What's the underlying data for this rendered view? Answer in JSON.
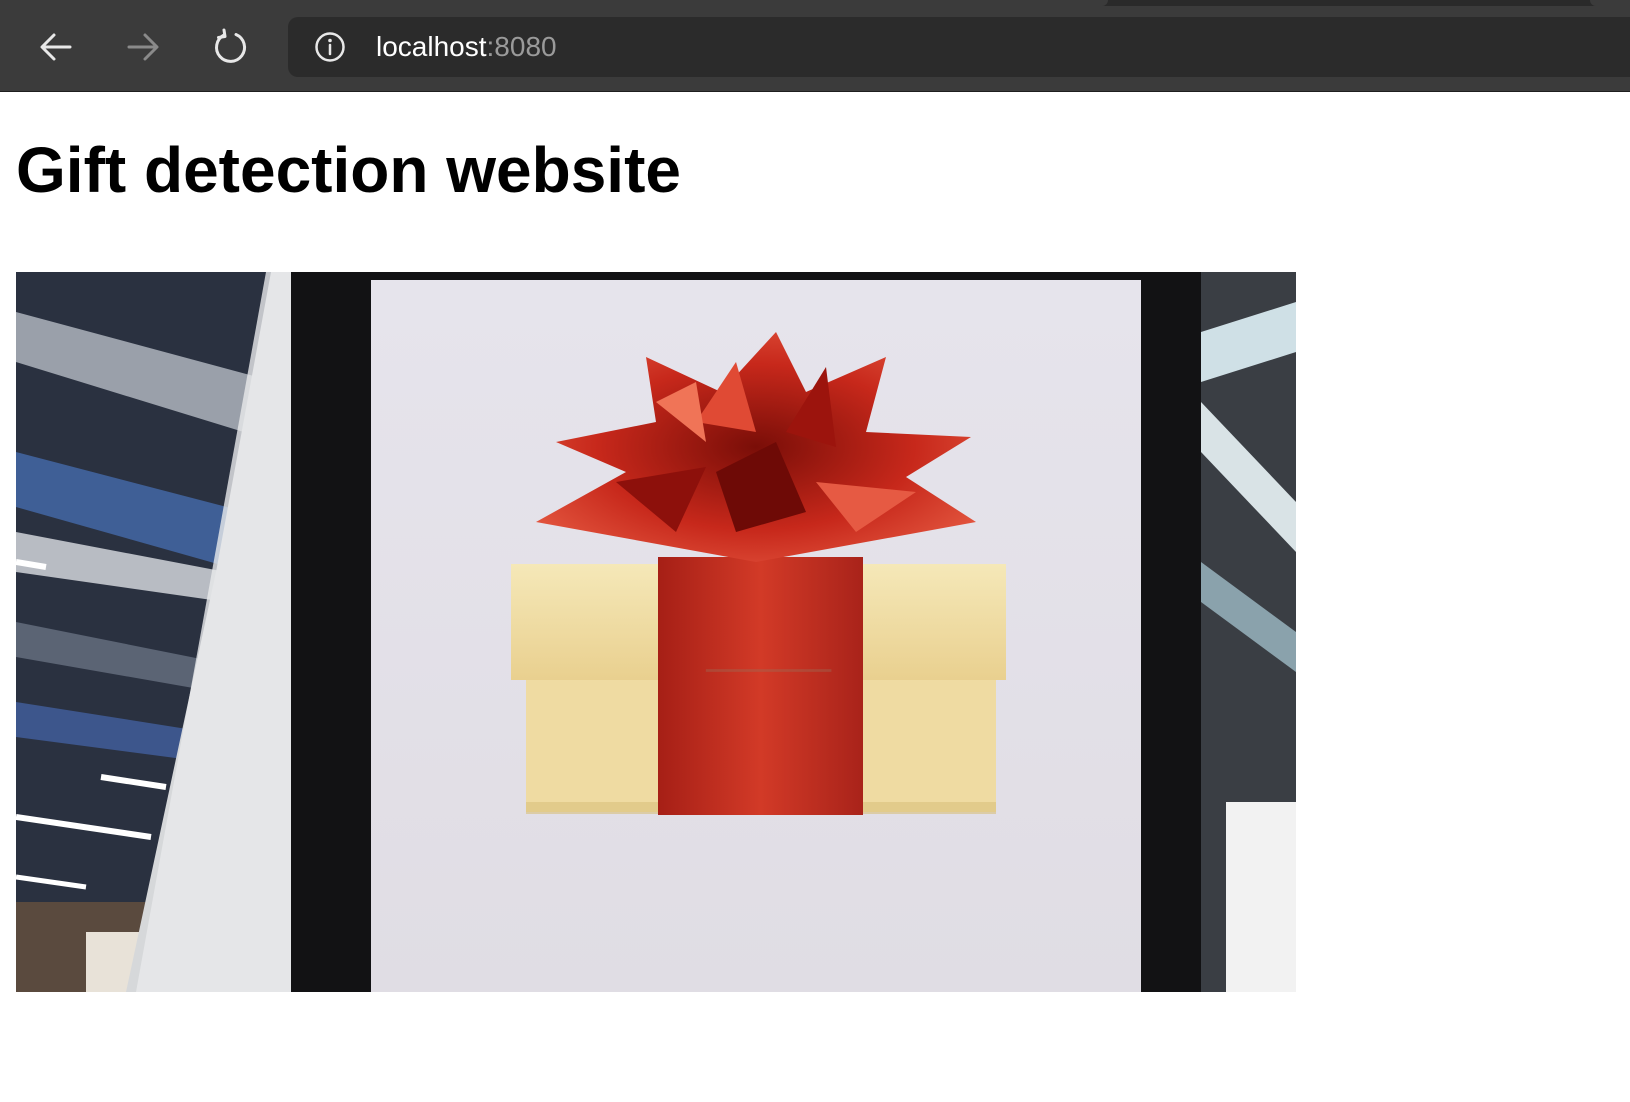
{
  "browser": {
    "url_host": "localhost",
    "url_port": ":8080",
    "icons": {
      "back": "arrow-left-icon",
      "forward": "arrow-right-icon",
      "reload": "reload-icon",
      "info": "info-icon"
    }
  },
  "page": {
    "title": "Gift detection website"
  },
  "webcam": {
    "content": "live webcam frame showing a gift box with a red bow on a tablet screen"
  },
  "colors": {
    "chrome_bg": "#3b3b3b",
    "address_bg": "#2b2b2b",
    "ribbon_red": "#c0281c",
    "box_cream": "#f1dfa6"
  }
}
